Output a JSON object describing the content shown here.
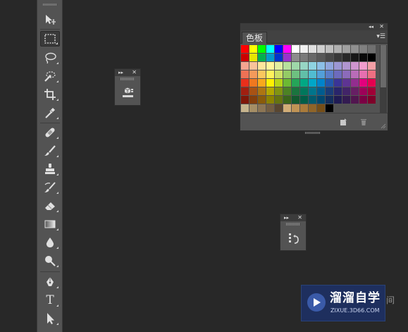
{
  "toolbar": {
    "tools": [
      {
        "name": "move-tool",
        "icon": "move-icon"
      },
      {
        "name": "rectangular-marquee-tool",
        "icon": "marquee-icon",
        "selected": true
      },
      {
        "name": "lasso-tool",
        "icon": "lasso-icon"
      },
      {
        "name": "quick-selection-tool",
        "icon": "quick-selection-icon"
      },
      {
        "name": "crop-tool",
        "icon": "crop-icon"
      },
      {
        "name": "eyedropper-tool",
        "icon": "eyedropper-icon"
      },
      {
        "name": "spot-healing-brush-tool",
        "icon": "bandage-icon"
      },
      {
        "name": "brush-tool",
        "icon": "brush-icon"
      },
      {
        "name": "clone-stamp-tool",
        "icon": "stamp-icon"
      },
      {
        "name": "history-brush-tool",
        "icon": "history-brush-icon"
      },
      {
        "name": "eraser-tool",
        "icon": "eraser-icon"
      },
      {
        "name": "gradient-tool",
        "icon": "gradient-icon"
      },
      {
        "name": "blur-tool",
        "icon": "drop-icon"
      },
      {
        "name": "dodge-tool",
        "icon": "dodge-icon"
      },
      {
        "name": "pen-tool",
        "icon": "pen-icon"
      },
      {
        "name": "type-tool",
        "icon": "type-icon",
        "label": "T"
      },
      {
        "name": "path-selection-tool",
        "icon": "path-selection-icon"
      }
    ]
  },
  "swatches_panel": {
    "tab_label": "色板",
    "rows": [
      [
        "#ff0000",
        "#ffff00",
        "#00ff00",
        "#00ffff",
        "#0000ff",
        "#ff00ff",
        "#ffffff",
        "#f0f0f0",
        "#e0e0e0",
        "#d0d0d0",
        "#c0c0c0",
        "#b0b0b0",
        "#a0a0a0",
        "#909090",
        "#808080",
        "#707070"
      ],
      [
        "#cc0000",
        "#e6e600",
        "#00b050",
        "#0099cc",
        "#0033cc",
        "#9933cc",
        "#8c8c8c",
        "#7a7a7a",
        "#686868",
        "#585858",
        "#484848",
        "#383838",
        "#282828",
        "#181818",
        "#0a0a0a",
        "#000000"
      ],
      [
        "#f4a590",
        "#f9c39a",
        "#fde59c",
        "#fff59d",
        "#e1eea0",
        "#b7df9d",
        "#9fd8a9",
        "#97d5c4",
        "#8fd3e1",
        "#8cbfe7",
        "#90a6dd",
        "#9b96d2",
        "#b095cf",
        "#cf95cf",
        "#f09ccc",
        "#f39fa6"
      ],
      [
        "#ee7155",
        "#f59a5b",
        "#fbc75d",
        "#fff25c",
        "#cde065",
        "#94cb65",
        "#6ec080",
        "#61bfa8",
        "#51bcd1",
        "#529fd9",
        "#5a7ec9",
        "#6d6bbd",
        "#8c6bba",
        "#b96cb8",
        "#e76fb0",
        "#ed6f82"
      ],
      [
        "#e92f1b",
        "#f0781f",
        "#f8a81c",
        "#fff100",
        "#b7d418",
        "#6cb933",
        "#25a558",
        "#00a884",
        "#00a6c8",
        "#0083cb",
        "#2256ab",
        "#3a3497",
        "#5e3493",
        "#932d8f",
        "#e3007d",
        "#e5004f"
      ],
      [
        "#a11f10",
        "#a85214",
        "#ad7512",
        "#b3a800",
        "#819412",
        "#4c8224",
        "#1a743e",
        "#00775c",
        "#00758c",
        "#005c8f",
        "#1a3c78",
        "#29256b",
        "#422468",
        "#671f64",
        "#9d0058",
        "#a00036"
      ],
      [
        "#7f1708",
        "#843f0c",
        "#8a5b0a",
        "#8c8300",
        "#657410",
        "#3b661b",
        "#125a2f",
        "#005d47",
        "#005b6e",
        "#004870",
        "#142e5e",
        "#201b54",
        "#331b51",
        "#51164f",
        "#7b0044",
        "#7e0029"
      ],
      [
        "#c6b48d",
        "#a58e65",
        "#8c7554",
        "#735d42",
        "#594630",
        "#d2ad77",
        "#c09355",
        "#a97a3a",
        "#8f6428",
        "#754e18",
        "#000000"
      ]
    ]
  },
  "watermark": {
    "name": "溜溜自学",
    "url": "ZIXUE.3D66.COM",
    "extra": "间"
  }
}
